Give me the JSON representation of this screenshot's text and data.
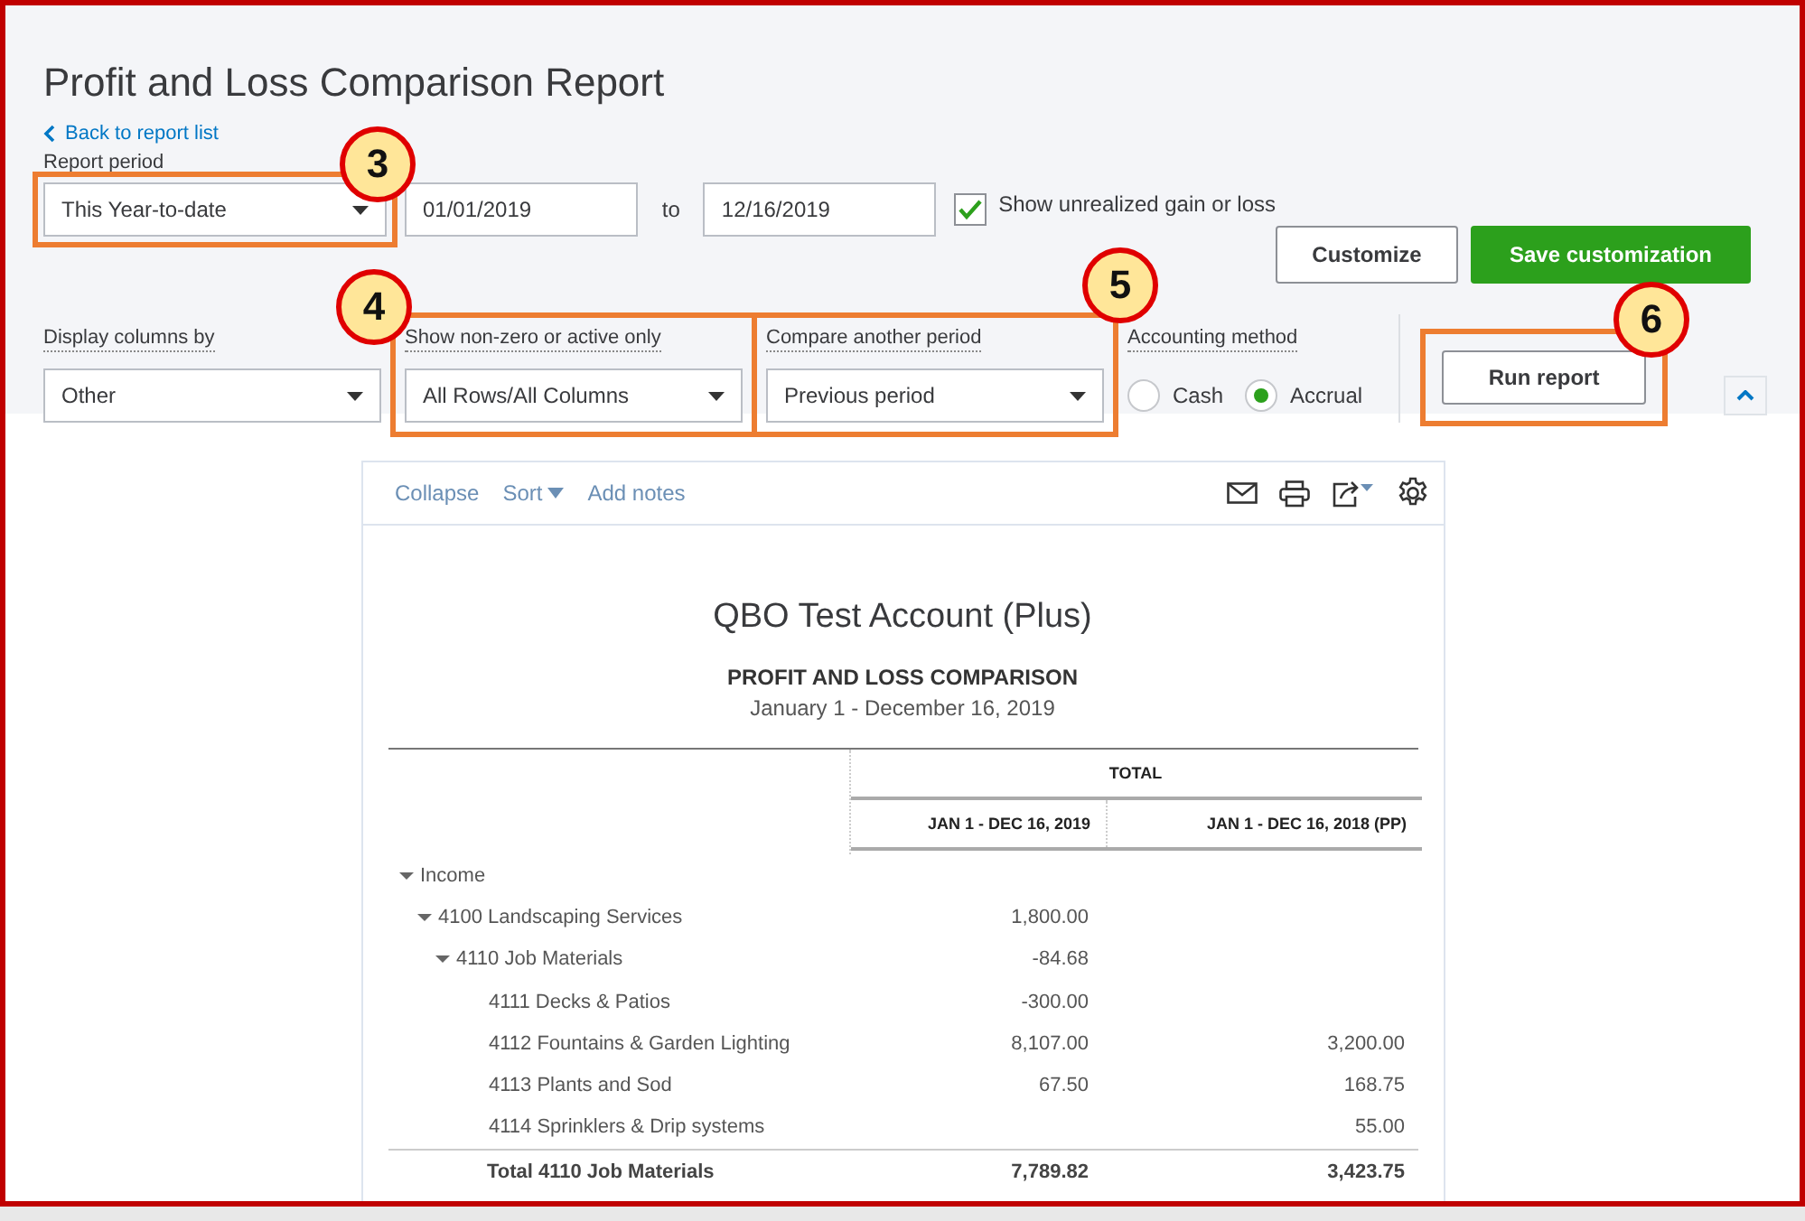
{
  "title": "Profit and Loss Comparison Report",
  "back_link": "Back to report list",
  "report_period": {
    "label": "Report period",
    "value": "This Year-to-date",
    "from": "01/01/2019",
    "to_label": "to",
    "to": "12/16/2019",
    "callout": "3"
  },
  "unrealized": {
    "label": "Show unrealized gain or loss",
    "checked": true
  },
  "buttons": [
    {
      "label": "Customize",
      "kind": "secondary"
    },
    {
      "label": "Save customization",
      "kind": "primary"
    }
  ],
  "filters": [
    {
      "label": "Display columns by",
      "value": "Other"
    },
    {
      "label": "Show non-zero or active only",
      "value": "All Rows/All Columns",
      "callout": "4"
    },
    {
      "label": "Compare another period",
      "value": "Previous period",
      "callout": "5"
    }
  ],
  "accounting_method": {
    "label": "Accounting method",
    "options": [
      {
        "label": "Cash",
        "selected": false
      },
      {
        "label": "Accrual",
        "selected": true
      }
    ]
  },
  "run_button": {
    "label": "Run report",
    "callout": "6"
  },
  "toolbar": [
    {
      "label": "Collapse",
      "kind": "link"
    },
    {
      "label": "Sort",
      "kind": "dropdown"
    },
    {
      "label": "Add notes",
      "kind": "link"
    }
  ],
  "report": {
    "company": "QBO Test Account (Plus)",
    "title": "PROFIT AND LOSS COMPARISON",
    "period": "January 1 - December 16, 2019",
    "group_header": "TOTAL",
    "columns": [
      "JAN 1 - DEC 16, 2019",
      "JAN 1 - DEC 16, 2018 (PP)"
    ],
    "rows": [
      {
        "label": "Income",
        "expanded": true,
        "children": [
          {
            "label": "4100 Landscaping Services",
            "expanded": true,
            "current": "1,800.00",
            "children": [
              {
                "label": "4110 Job Materials",
                "expanded": true,
                "current": "-84.68",
                "children": [
                  {
                    "label": "4111 Decks & Patios",
                    "current": "-300.00"
                  },
                  {
                    "label": "4112 Fountains & Garden Lighting",
                    "current": "8,107.00",
                    "previous": "3,200.00"
                  },
                  {
                    "label": "4113 Plants and Sod",
                    "current": "67.50",
                    "previous": "168.75"
                  },
                  {
                    "label": "4114 Sprinklers & Drip systems",
                    "previous": "55.00"
                  }
                ],
                "total": {
                  "label": "Total 4110 Job Materials",
                  "current": "7,789.82",
                  "previous": "3,423.75"
                }
              }
            ]
          }
        ]
      }
    ]
  }
}
